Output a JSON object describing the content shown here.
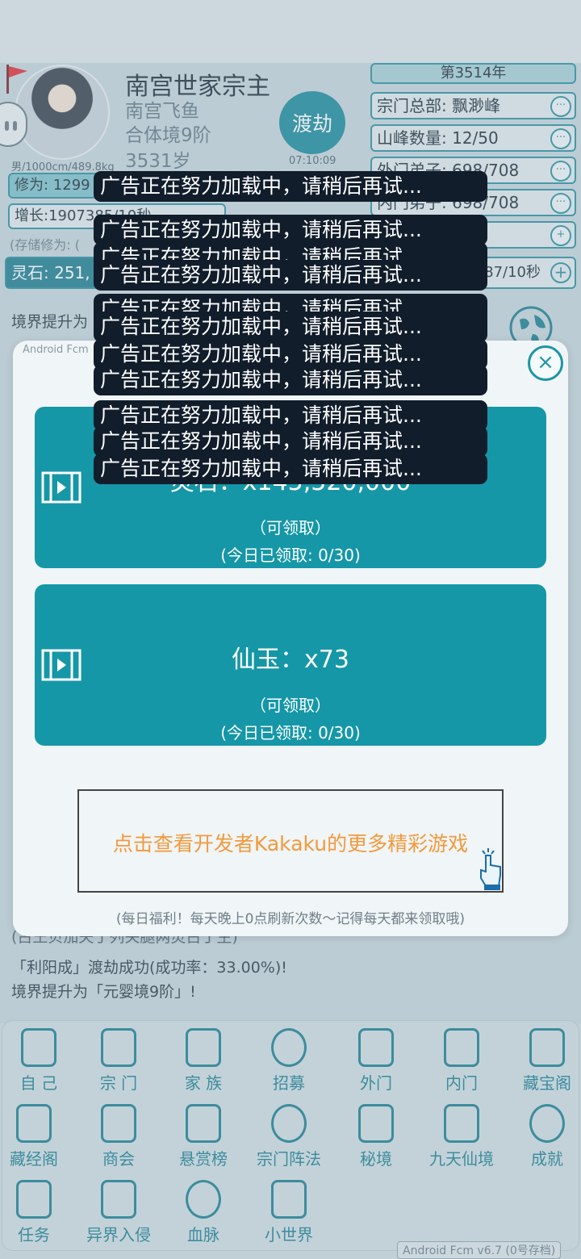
{
  "header": {
    "title": "南宫世家宗主",
    "character_name": "南宫飞鱼",
    "realm": "合体境9阶",
    "age": "3531岁",
    "gender_info": "男/1000cm/489.8kg",
    "dujie_label": "渡劫",
    "dujie_timer": "07:10:09"
  },
  "sect": {
    "year": "第3514年",
    "rows": [
      {
        "label": "宗门总部: 飘渺峰",
        "action": "···"
      },
      {
        "label": "山峰数量: 12/50",
        "action": "···"
      },
      {
        "label": "外门弟子: 698/708",
        "action": "···"
      },
      {
        "label": "内门弟子: 698/708",
        "action": "···"
      },
      {
        "label": "",
        "action": "+"
      }
    ]
  },
  "stats": {
    "xiuwei": "修为: 1299",
    "growth": "增长:1907385/10秒",
    "stored": "(存储修为: (",
    "lingshi_left": "灵石: 251,",
    "lingshi_right": "87/10秒",
    "plus": "+"
  },
  "log": [
    "境界提升为",
    "(古王贝加夫丁列关腿两灵古丁生)",
    "「利阳成」渡劫成功(成功率：33.00%)!",
    "境界提升为「元婴境9阶」!"
  ],
  "modal": {
    "tag": "Android Fcm",
    "close": "×",
    "rewards": [
      {
        "title": "灵石：x145,520,000",
        "status": "（可领取）",
        "count": "(今日已领取: 0/30)"
      },
      {
        "title": "仙玉：x73",
        "status": "（可领取）",
        "count": "(今日已领取: 0/30)"
      }
    ],
    "dev_link": "点击查看开发者Kakaku的更多精彩游戏",
    "footer": "(每日福利！每天晚上0点刷新次数～记得每天都来领取哦)"
  },
  "toast_message": "广告正在努力加载中，请稍后再试...",
  "nav": [
    {
      "label": "自 己",
      "icon": "person-icon"
    },
    {
      "label": "宗 门",
      "icon": "sect-building-icon"
    },
    {
      "label": "家 族",
      "icon": "family-tree-icon"
    },
    {
      "label": "招募",
      "icon": "recruit-search-icon"
    },
    {
      "label": "外门",
      "icon": "outer-gate-icon"
    },
    {
      "label": "内门",
      "icon": "inner-gate-icon"
    },
    {
      "label": "藏宝阁",
      "icon": "treasure-house-icon"
    },
    {
      "label": "藏经阁",
      "icon": "scripture-pavilion-icon"
    },
    {
      "label": "商会",
      "icon": "shop-icon"
    },
    {
      "label": "悬赏榜",
      "icon": "bounty-board-icon"
    },
    {
      "label": "宗门阵法",
      "icon": "formation-bagua-icon"
    },
    {
      "label": "秘境",
      "icon": "mountain-icon"
    },
    {
      "label": "九天仙境",
      "icon": "fairyland-icon"
    },
    {
      "label": "成就",
      "icon": "target-icon"
    },
    {
      "label": "任务",
      "icon": "task-list-icon"
    },
    {
      "label": "异界入侵",
      "icon": "invasion-demon-icon"
    },
    {
      "label": "血脉",
      "icon": "bloodline-atom-icon"
    },
    {
      "label": "小世界",
      "icon": "small-world-icon"
    }
  ],
  "version": "Android Fcm v6.7 (0号存档)"
}
